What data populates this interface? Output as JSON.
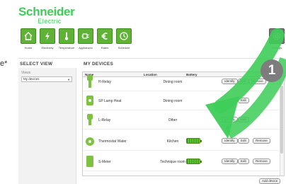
{
  "edge_text": "e*",
  "logo": {
    "brand": "Schneider",
    "sub": "Electric"
  },
  "nav": [
    {
      "label": "Home",
      "icon": "home-icon"
    },
    {
      "label": "Electricity",
      "icon": "lightning-icon"
    },
    {
      "label": "Temperature",
      "icon": "thermometer-icon"
    },
    {
      "label": "Appliances",
      "icon": "plug-icon"
    },
    {
      "label": "Rates",
      "icon": "euro-icon"
    },
    {
      "label": "Schedule",
      "icon": "clock-icon"
    }
  ],
  "settings": {
    "label": "Settings",
    "icon": "gear-icon"
  },
  "select_view": {
    "title": "SELECT VIEW",
    "views_label": "Views",
    "selected": "My devices"
  },
  "my_devices": {
    "title": "MY DEVICES",
    "columns": {
      "name": "Name",
      "location": "Location",
      "battery": "Battery"
    },
    "rows": [
      {
        "name": "H-Relay",
        "location": "Dining room",
        "battery": false,
        "buttons": [
          "Identify",
          "Edit",
          "Remove"
        ]
      },
      {
        "name": "SP Lamp Heat",
        "location": "Dining room",
        "battery": false,
        "buttons": [
          "Edit"
        ]
      },
      {
        "name": "L-Relay",
        "location": "Other",
        "battery": false,
        "buttons": [
          "Identify",
          "Edit"
        ]
      },
      {
        "name": "Thermostat Water",
        "location": "Kitchen",
        "battery": true,
        "buttons": [
          "Identify",
          "Edit",
          "Remove"
        ]
      },
      {
        "name": "S-Meter",
        "location": "Technique room",
        "battery": true,
        "buttons": [
          "Identify",
          "Edit",
          "Remove"
        ]
      }
    ],
    "add_button": "Add device"
  },
  "callout": {
    "number": "1",
    "arrow_color": "#3dcd58",
    "badge_color": "#7d7d7d"
  },
  "colors": {
    "brand_green": "#3dcd58",
    "tile_green": "#5fb236",
    "battery_green": "#3ea51a"
  }
}
